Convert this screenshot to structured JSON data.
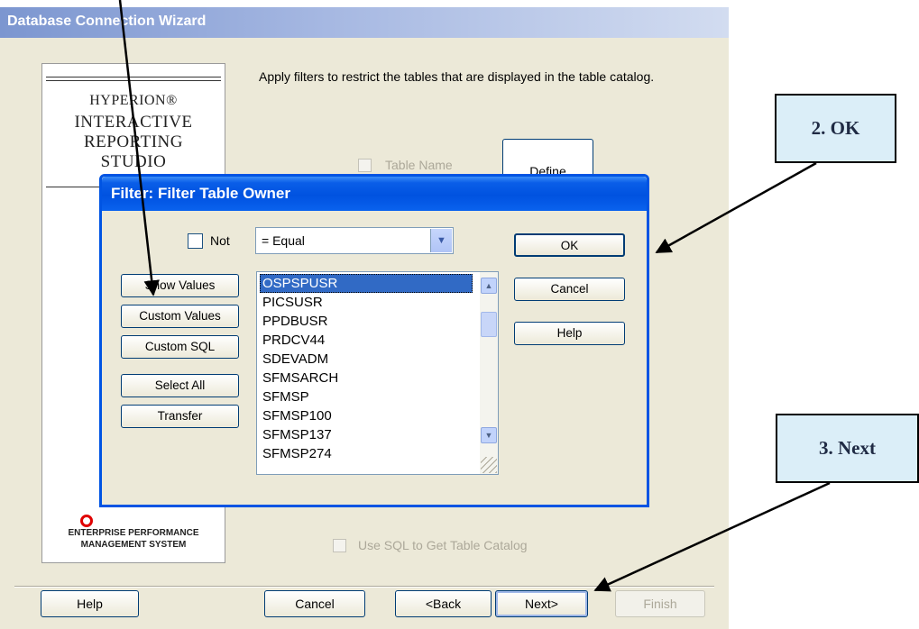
{
  "wizard": {
    "title": "Database Connection Wizard",
    "instruction": "Apply filters to restrict the tables that are displayed in the table catalog.",
    "table_name_label": "Table Name",
    "define_label": "Define",
    "use_sql_label": "Use SQL to Get Table Catalog",
    "buttons": {
      "help": "Help",
      "cancel": "Cancel",
      "back": "<Back",
      "next": "Next>",
      "finish": "Finish"
    },
    "brand": {
      "line1": "HYPERION®",
      "line2": "INTERACTIVE",
      "line3": "REPORTING",
      "line4": "STUDIO",
      "foot1": "ENTERPRISE PERFORMANCE",
      "foot2": "MANAGEMENT SYSTEM"
    }
  },
  "filter": {
    "title": "Filter: Filter Table Owner",
    "not_label": "Not",
    "operator": "= Equal",
    "buttons": {
      "show_values": "Show Values",
      "custom_values": "Custom Values",
      "custom_sql": "Custom SQL",
      "select_all": "Select All",
      "transfer": "Transfer",
      "ok": "OK",
      "cancel": "Cancel",
      "help": "Help"
    },
    "values": [
      "OSPSPUSR",
      "PICSUSR",
      "PPDBUSR",
      "PRDCV44",
      "SDEVADM",
      "SFMSARCH",
      "SFMSP",
      "SFMSP100",
      "SFMSP137",
      "SFMSP274"
    ],
    "selected_value": "OSPSPUSR"
  },
  "callouts": {
    "ok": "2. OK",
    "next": "3. Next"
  },
  "icons": [
    "chevron-down-icon",
    "scroll-up-icon",
    "scroll-down-icon",
    "size-grip-icon",
    "oracle-logo-icon"
  ]
}
